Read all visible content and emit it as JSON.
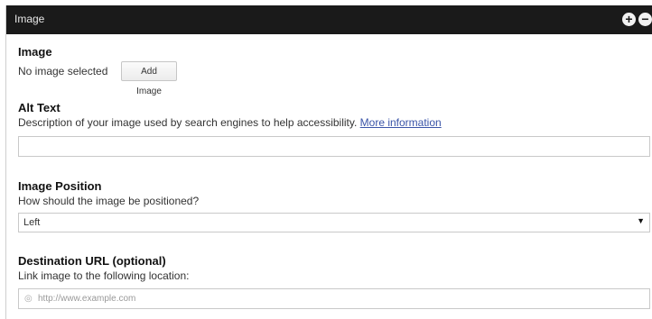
{
  "panel": {
    "title": "Image",
    "add_icon": "plus-circle-icon",
    "remove_icon": "minus-circle-icon"
  },
  "image_field": {
    "label": "Image",
    "status": "No image selected",
    "button_label": "Add Image"
  },
  "alt_text": {
    "label": "Alt Text",
    "description": "Description of your image used by search engines to help accessibility.",
    "link_text": "More information",
    "value": ""
  },
  "image_position": {
    "label": "Image Position",
    "description": "How should the image be positioned?",
    "selected": "Left"
  },
  "destination_url": {
    "label": "Destination URL (optional)",
    "description": "Link image to the following location:",
    "placeholder": "http://www.example.com",
    "icon": "globe-icon"
  },
  "colors": {
    "titlebar_bg": "#1a1a1a",
    "link": "#3a54a8"
  }
}
